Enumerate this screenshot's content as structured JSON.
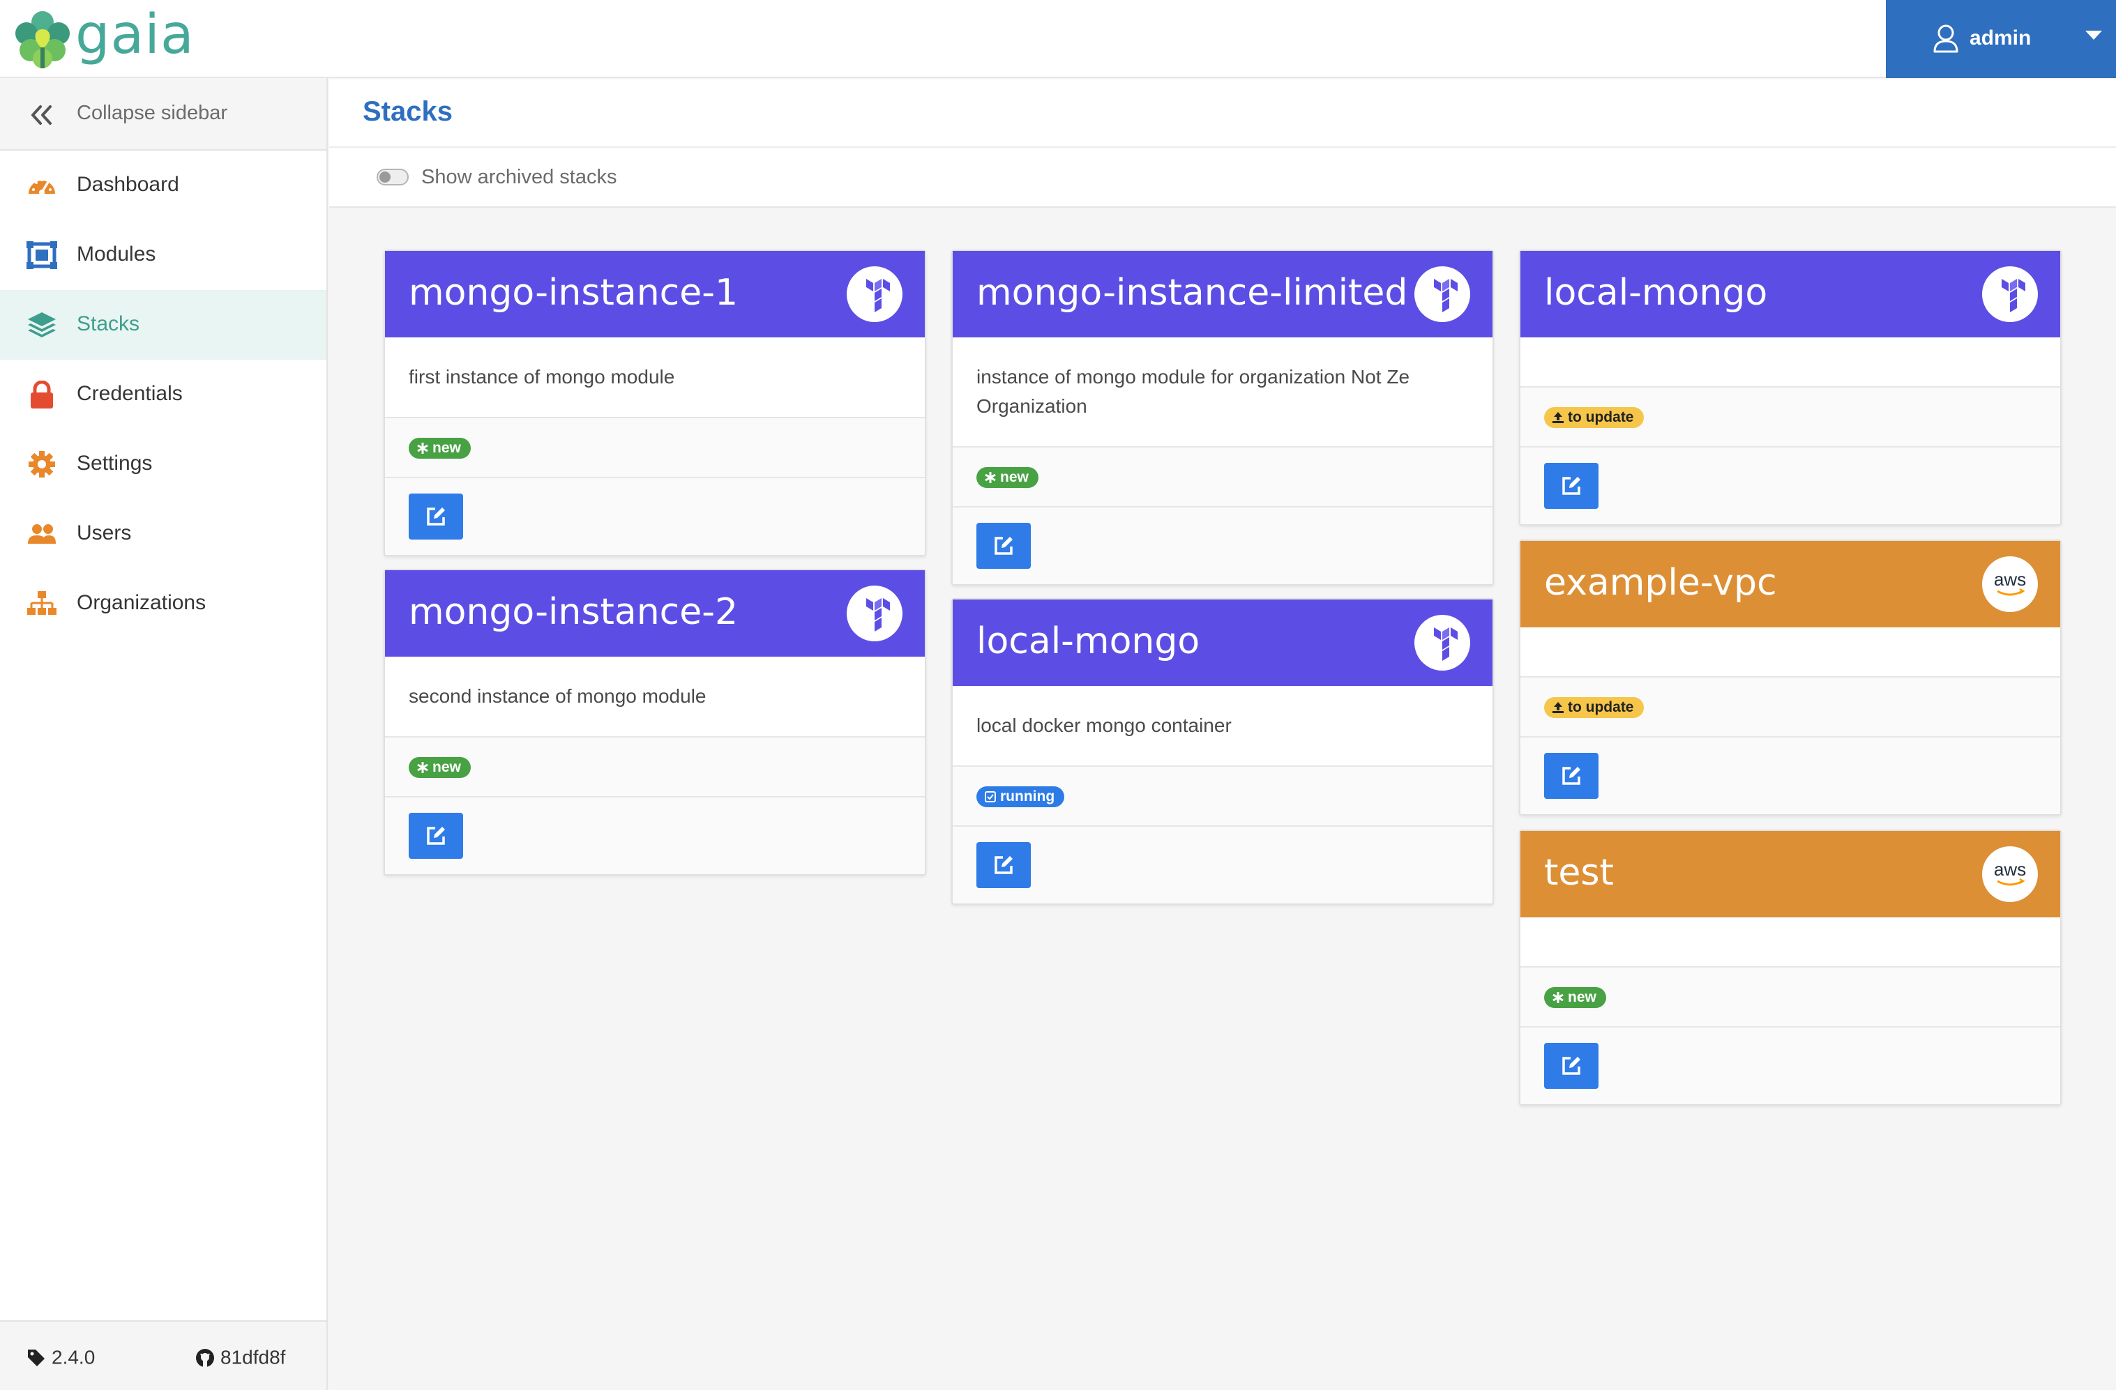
{
  "app": {
    "logo_text": "gaia",
    "user": "admin"
  },
  "sidebar": {
    "collapse_label": "Collapse sidebar",
    "items": [
      {
        "label": "Dashboard",
        "icon": "tachometer-icon",
        "active": false
      },
      {
        "label": "Modules",
        "icon": "modules-icon",
        "active": false
      },
      {
        "label": "Stacks",
        "icon": "layers-icon",
        "active": true
      },
      {
        "label": "Credentials",
        "icon": "lock-icon",
        "active": false
      },
      {
        "label": "Settings",
        "icon": "gear-icon",
        "active": false
      },
      {
        "label": "Users",
        "icon": "users-icon",
        "active": false
      },
      {
        "label": "Organizations",
        "icon": "sitemap-icon",
        "active": false
      }
    ],
    "footer": {
      "version": "2.4.0",
      "commit": "81dfd8f"
    }
  },
  "page": {
    "title": "Stacks",
    "filter_label": "Show archived stacks",
    "show_archived": false
  },
  "cards": [
    {
      "title": "mongo-instance-1",
      "provider": "terraform",
      "description": "first instance of mongo module",
      "state": "new"
    },
    {
      "title": "mongo-instance-2",
      "provider": "terraform",
      "description": "second instance of mongo module",
      "state": "new"
    },
    {
      "title": "mongo-instance-limited",
      "provider": "terraform",
      "description": "instance of mongo module for organization Not Ze Organization",
      "state": "new"
    },
    {
      "title": "local-mongo",
      "provider": "terraform",
      "description": "local docker mongo container",
      "state": "running"
    },
    {
      "title": "local-mongo",
      "provider": "terraform",
      "description": "",
      "state": "to update"
    },
    {
      "title": "example-vpc",
      "provider": "aws",
      "description": "",
      "state": "to update"
    },
    {
      "title": "test",
      "provider": "aws",
      "description": "",
      "state": "new"
    }
  ],
  "colors": {
    "terraform": "#5c4ee5",
    "aws": "#dd8f35",
    "primary": "#2f6fc0",
    "active_nav": "#3e9e8e",
    "badge_new": "#48a244",
    "badge_update": "#f6c64a",
    "badge_running": "#2d7be6"
  },
  "provider_labels": {
    "aws": "aws"
  }
}
